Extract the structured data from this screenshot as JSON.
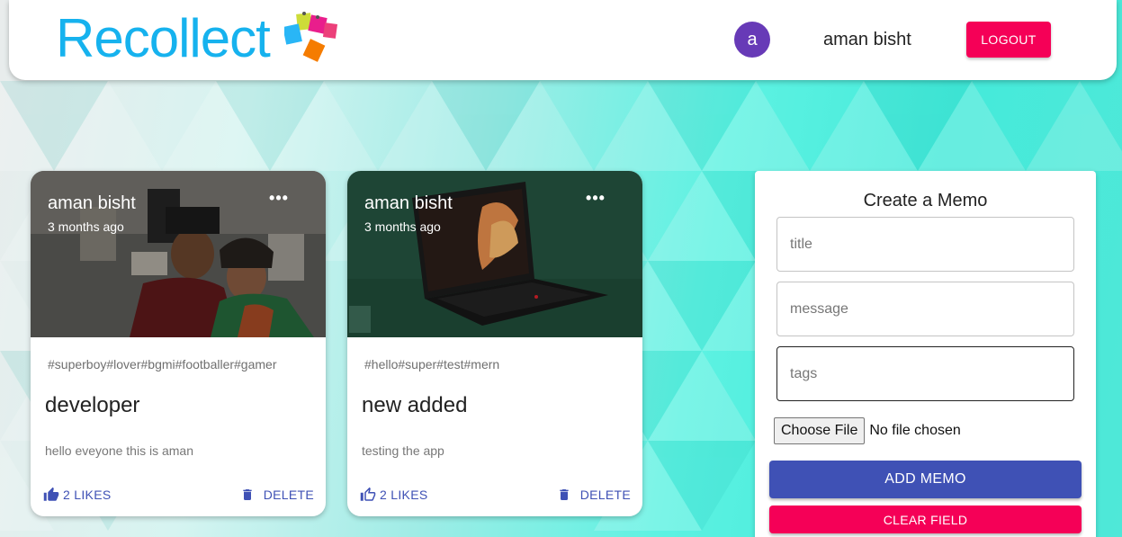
{
  "header": {
    "brand": "Recollect",
    "avatar_letter": "a",
    "username": "aman bisht",
    "logout_label": "LOGOUT"
  },
  "posts": [
    {
      "author": "aman bisht",
      "time": "3 months ago",
      "more_icon": "•••",
      "tags": "#superboy#lover#bgmi#footballer#gamer",
      "title": "developer",
      "message": "hello eveyone this is aman",
      "likes_label": "2 LIKES",
      "delete_label": "DELETE"
    },
    {
      "author": "aman bisht",
      "time": "3 months ago",
      "more_icon": "•••",
      "tags": "#hello#super#test#mern",
      "title": "new added",
      "message": "testing the app",
      "likes_label": "2 LIKES",
      "delete_label": "DELETE"
    }
  ],
  "form": {
    "heading": "Create a Memo",
    "title_placeholder": "title",
    "message_placeholder": "message",
    "tags_placeholder": "tags",
    "choose_file_label": "Choose File",
    "file_status": "No file chosen",
    "submit_label": "ADD MEMO",
    "clear_label": "CLEAR FIELD"
  },
  "colors": {
    "brand": "#16b2ee",
    "primary": "#3f51b5",
    "secondary": "#f50057",
    "avatar": "#673ab7"
  },
  "icons": {
    "like": "thumb-up-icon",
    "delete": "trash-icon",
    "more": "more-horizontal-icon"
  }
}
